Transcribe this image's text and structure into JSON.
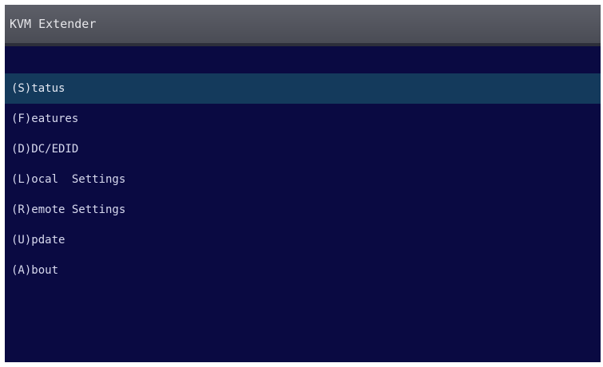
{
  "window": {
    "title": "KVM Extender"
  },
  "menu": {
    "selected_index": 0,
    "items": [
      {
        "label": "(S)tatus"
      },
      {
        "label": "(F)eatures"
      },
      {
        "label": "(D)DC/EDID"
      },
      {
        "label": "(L)ocal  Settings"
      },
      {
        "label": "(R)emote Settings"
      },
      {
        "label": "(U)pdate"
      },
      {
        "label": "(A)bout"
      }
    ]
  },
  "colors": {
    "background": "#0a0a42",
    "titlebar": "#55575f",
    "selection": "#143a5c",
    "text": "#d7d9ee"
  }
}
